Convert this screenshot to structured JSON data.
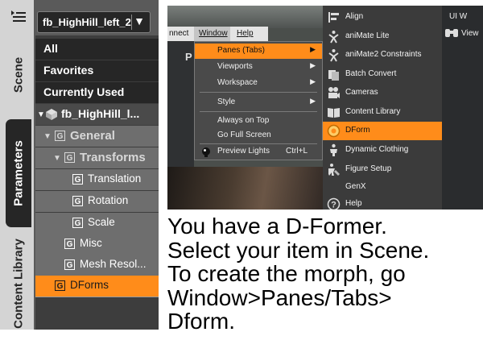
{
  "left_panel": {
    "node_selector": "fb_HighHill_left_2",
    "side_tabs": {
      "scene": "Scene",
      "parameters": "Parameters",
      "content_library": "Content Library"
    },
    "tree": {
      "all": "All",
      "favorites": "Favorites",
      "currently_used": "Currently Used",
      "node": "fb_HighHill_l...",
      "general": "General",
      "transforms": "Transforms",
      "translation": "Translation",
      "rotation": "Rotation",
      "scale": "Scale",
      "misc": "Misc",
      "mesh_resolution": "Mesh Resol...",
      "dforms": "DForms"
    }
  },
  "screenshot": {
    "menubar": {
      "connect": "nnect",
      "window": "Window",
      "help": "Help"
    },
    "background_letter": "P",
    "window_menu": [
      {
        "label": "Panes (Tabs)",
        "arrow": "▶"
      },
      {
        "label": "Viewports",
        "arrow": "▶"
      },
      {
        "label": "Workspace",
        "arrow": "▶"
      },
      {
        "label": "Style",
        "arrow": "▶"
      },
      {
        "label": "Always on Top"
      },
      {
        "label": "Go Full Screen"
      },
      {
        "label": "Preview Lights",
        "shortcut": "Ctrl+L"
      }
    ],
    "panes_submenu": [
      {
        "label": "Align",
        "icon": "align-icon"
      },
      {
        "label": "aniMate Lite",
        "icon": "animate-figure-icon"
      },
      {
        "label": "aniMate2 Constraints",
        "icon": "animate-constraints-icon"
      },
      {
        "label": "Batch Convert",
        "icon": "batch-convert-icon"
      },
      {
        "label": "Cameras",
        "icon": "camera-icon"
      },
      {
        "label": "Content Library",
        "icon": "book-icon"
      },
      {
        "label": "DForm",
        "icon": "dform-icon"
      },
      {
        "label": "Dynamic Clothing",
        "icon": "dynamic-clothing-icon"
      },
      {
        "label": "Figure Setup",
        "icon": "figure-setup-icon"
      },
      {
        "label": "GenX",
        "icon": ""
      },
      {
        "label": "Help",
        "icon": "help-icon"
      }
    ],
    "right_column": {
      "ui_label": "UI W",
      "view_label": "View"
    }
  },
  "instructions": {
    "line1": "You have a D-Former.",
    "line2": "Select your item in Scene.",
    "line3": "To create the morph, go",
    "line4": "Window>Panes/Tabs>",
    "line5": "Dform."
  },
  "colors": {
    "accent_orange": "#ff8c1a",
    "panel_dark": "#262626",
    "panel_mid": "#6e6e6e"
  }
}
